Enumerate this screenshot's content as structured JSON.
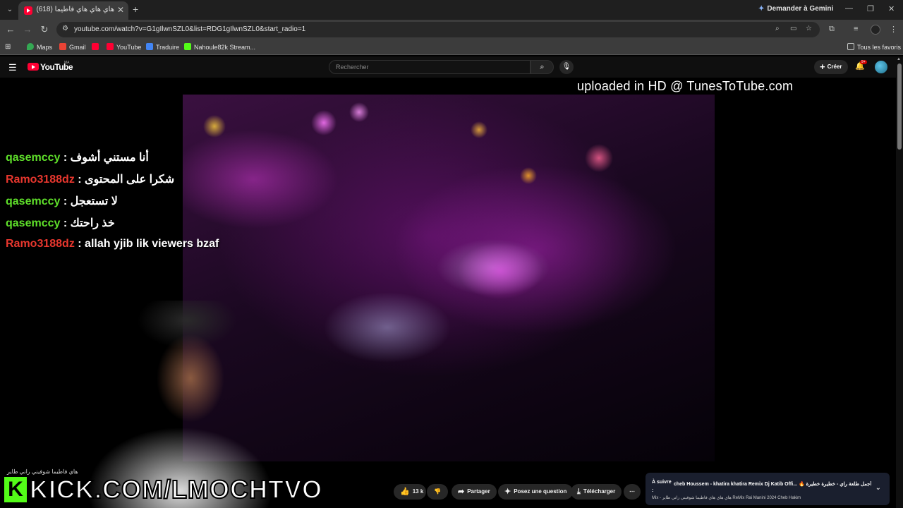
{
  "browser": {
    "tab_title": "هاي هاي هاي فاطيما (618)",
    "gemini_label": "Demander à Gemini",
    "url": "youtube.com/watch?v=G1gIlwnSZL0&list=RDG1gIlwnSZL0&start_radio=1",
    "bookmarks": [
      "Maps",
      "Gmail",
      "",
      "YouTube",
      "Traduire",
      "Nahoule82k Stream..."
    ],
    "all_bookmarks": "Tous les favoris"
  },
  "youtube": {
    "logo_text": "YouTube",
    "region": "MA",
    "search_placeholder": "Rechercher",
    "create_label": "Créer",
    "notif_badge": "9+"
  },
  "video": {
    "watermark": "uploaded in HD @ TunesToTube.com",
    "chat": [
      {
        "user": "qasemccy",
        "color": "#5fe02a",
        "msg": "أنا مستني أشوف"
      },
      {
        "user": "Ramo3188dz",
        "color": "#e8372e",
        "msg": "شكرا على المحتوى"
      },
      {
        "user": "qasemccy",
        "color": "#5fe02a",
        "msg": "لا تستعجل"
      },
      {
        "user": "qasemccy",
        "color": "#5fe02a",
        "msg": "خذ راحتك"
      },
      {
        "user": "Ramo3188dz",
        "color": "#e8372e",
        "msg": "allah yjib lik viewers bzaf"
      }
    ],
    "kick_text": "KICK.COM/LMOCHTVO",
    "kick_k": "K",
    "tiny_title": "هاي فاطيما شوفيني راني طاير"
  },
  "actions": {
    "likes": "13 k",
    "share": "Partager",
    "ask": "Posez une question",
    "download": "Télécharger"
  },
  "up_next": {
    "label": "À suivre :",
    "title": "cheb Houssem - khatira khatira Remix Dj Katib Offi... 🔥 أجمل طلعة راي - خطيرة خطيرة",
    "subtitle": "Mix - هاي هاي هاي فاطيما شوفيني راني طاير ReMix Rai Manini 2024 Cheb Hakim"
  }
}
